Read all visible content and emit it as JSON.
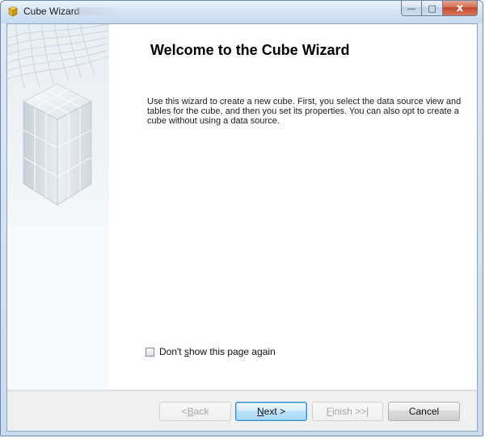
{
  "window": {
    "title": "Cube Wizard",
    "title_icon": "cube-icon",
    "caption_buttons": {
      "minimize_icon": "minimize-icon",
      "maximize_icon": "maximize-icon",
      "close_icon": "close-icon",
      "minimize_glyph": "—",
      "maximize_glyph": "□",
      "close_glyph": "x"
    }
  },
  "wizard": {
    "heading": "Welcome to the Cube Wizard",
    "description": "Use this wizard to create a new cube. First, you select the data source view and tables for the cube, and then you set its properties. You can also opt to create a cube without using a data source.",
    "checkbox": {
      "prefix": "Don't ",
      "underlined": "s",
      "suffix": "how this page again",
      "checked": false
    }
  },
  "buttons": {
    "back": {
      "prefix": "< ",
      "underlined": "B",
      "suffix": "ack",
      "enabled": false
    },
    "next": {
      "underlined": "N",
      "suffix": "ext >",
      "enabled": true,
      "default": true
    },
    "finish": {
      "underlined": "F",
      "suffix": "inish >>|",
      "enabled": false
    },
    "cancel": {
      "label": "Cancel",
      "enabled": true
    }
  },
  "colors": {
    "title_bar": "#d4e3f3",
    "close_button": "#c3472b",
    "default_button_border": "#3b8fd1",
    "disabled_text": "#a4a7ab"
  }
}
